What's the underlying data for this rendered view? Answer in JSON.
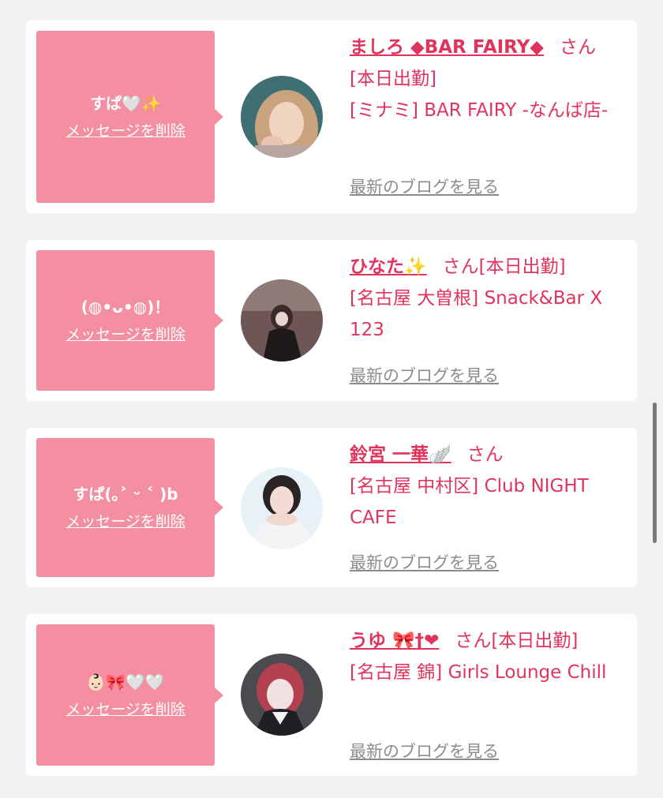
{
  "cards": [
    {
      "message": "すぱ🤍✨",
      "delete_label": "メッセージを削除",
      "name": "ましろ ◆BAR FAIRY◆",
      "honorific": "さん",
      "status": "[本日出勤]",
      "shop": "[ミナミ] BAR FAIRY -なんば店-",
      "blog_label": "最新のブログを見る",
      "avatar_icon": "profile-photo"
    },
    {
      "message": "(◍•ᴗ•◍)！",
      "delete_label": "メッセージを削除",
      "name": "ひなた✨",
      "honorific": "さん",
      "status": "[本日出勤]",
      "shop": "[名古屋 大曽根] Snack&Bar X 123",
      "blog_label": "最新のブログを見る",
      "avatar_icon": "profile-photo"
    },
    {
      "message": "すぱ(｡˃ ᵕ ˂ )b",
      "delete_label": "メッセージを削除",
      "name": "鈴宮 一華🪽",
      "honorific": "さん",
      "status": "",
      "shop": "[名古屋 中村区] Club NIGHT CAFE",
      "blog_label": "最新のブログを見る",
      "avatar_icon": "profile-photo"
    },
    {
      "message": "👶🏻🎀🤍🤍",
      "delete_label": "メッセージを削除",
      "name": "うゆ 🎀†❤",
      "honorific": "さん",
      "status": "[本日出勤]",
      "shop": "[名古屋 錦] Girls Lounge Chill",
      "blog_label": "最新のブログを見る",
      "avatar_icon": "profile-photo"
    }
  ],
  "colors": {
    "page_background": "#f2f2f2",
    "bubble": "#f38fa1",
    "accent_text": "#e0345c",
    "muted_link": "#8c8c8c"
  }
}
